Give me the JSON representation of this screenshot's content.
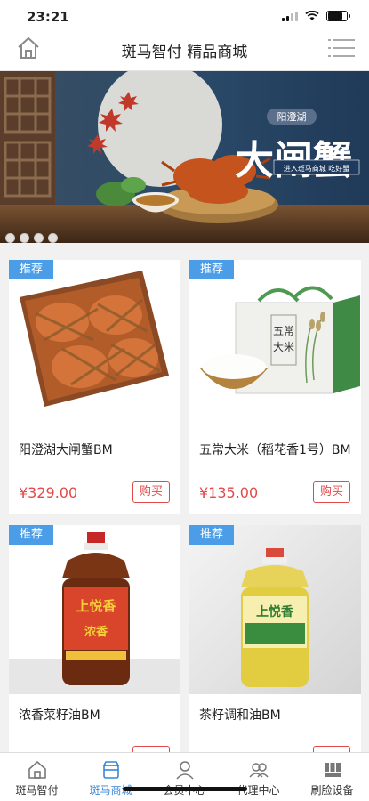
{
  "status": {
    "time": "23:21"
  },
  "header": {
    "title": "斑马智付 精品商城"
  },
  "banner": {
    "text_main": "大闸蟹",
    "text_sub": "阳澄湖",
    "text_tag": "进入斑马商城 吃好蟹"
  },
  "products": [
    {
      "badge": "推荐",
      "name": "阳澄湖大闸蟹BM",
      "price": "¥329.00",
      "buy_label": "购买"
    },
    {
      "badge": "推荐",
      "name": "五常大米（稻花香1号）BM",
      "price": "¥135.00",
      "buy_label": "购买",
      "box_text": "五常大米"
    },
    {
      "badge": "推荐",
      "name": "浓香菜籽油BM",
      "price": "",
      "buy_label": "",
      "bottle_brand": "上悦香",
      "bottle_sub": "浓香"
    },
    {
      "badge": "推荐",
      "name": "茶籽调和油BM",
      "price": "",
      "buy_label": "",
      "bottle_brand": "上悦香"
    }
  ],
  "tabs": [
    {
      "label": "斑马智付",
      "icon": "home-icon"
    },
    {
      "label": "斑马商城",
      "icon": "shop-icon"
    },
    {
      "label": "会员中心",
      "icon": "user-icon"
    },
    {
      "label": "代理中心",
      "icon": "group-icon"
    },
    {
      "label": "刷脸设备",
      "icon": "device-icon"
    }
  ],
  "colors": {
    "accent": "#3b86d6",
    "badge": "#4a9de6",
    "price": "#e24a4a"
  }
}
